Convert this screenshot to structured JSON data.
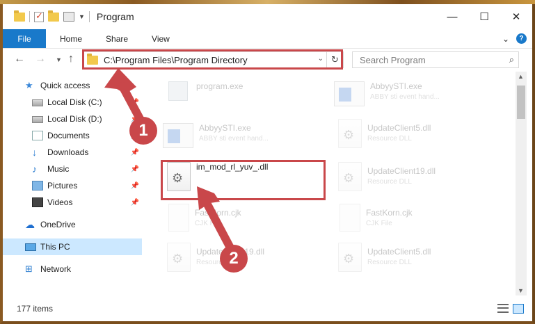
{
  "window": {
    "title": "Program",
    "minimize_glyph": "—",
    "maximize_glyph": "☐",
    "close_glyph": "✕"
  },
  "ribbon": {
    "tabs": [
      "File",
      "Home",
      "Share",
      "View"
    ],
    "expand_glyph": "⌄",
    "help_glyph": "?"
  },
  "address": {
    "path": "C:\\Program Files\\Program Directory",
    "search_placeholder": "Search Program"
  },
  "nav_pane": {
    "items": [
      {
        "label": "Quick access",
        "icon": "star-icon"
      },
      {
        "label": "Local Disk (C:)",
        "icon": "disk-icon"
      },
      {
        "label": "Local Disk (D:)",
        "icon": "disk-icon"
      },
      {
        "label": "Documents",
        "icon": "documents-icon"
      },
      {
        "label": "Downloads",
        "icon": "download-icon"
      },
      {
        "label": "Music",
        "icon": "music-icon"
      },
      {
        "label": "Pictures",
        "icon": "pictures-icon"
      },
      {
        "label": "Videos",
        "icon": "videos-icon"
      },
      {
        "label": "OneDrive",
        "icon": "cloud-icon"
      },
      {
        "label": "This PC",
        "icon": "computer-icon"
      },
      {
        "label": "Network",
        "icon": "network-icon"
      }
    ]
  },
  "files": [
    {
      "name": "program.exe",
      "type": "",
      "icon": "program-icon"
    },
    {
      "name": "AbbyySTI.exe",
      "type": "ABBY sti event hand...",
      "icon": "exe-icon"
    },
    {
      "name": "AbbyySTI.exe",
      "type": "ABBY sti event hand...",
      "icon": "exe-icon"
    },
    {
      "name": "UpdateClient5.dll",
      "type": "Resource DLL",
      "icon": "dll-icon"
    },
    {
      "name": "im_mod_rl_yuv_.dll",
      "type": "",
      "icon": "dll-icon"
    },
    {
      "name": "UpdateClient19.dll",
      "type": "Resource DLL",
      "icon": "dll-icon"
    },
    {
      "name": "FastKorn.cjk",
      "type": "CJK File",
      "icon": "cjk-icon"
    },
    {
      "name": "FastKorn.cjk",
      "type": "CJK File",
      "icon": "cjk-icon"
    },
    {
      "name": "UpdateClient19.dll",
      "type": "Resource DLL",
      "icon": "dll-icon"
    },
    {
      "name": "UpdateClient5.dll",
      "type": "Resource DLL",
      "icon": "dll-icon"
    }
  ],
  "status": {
    "item_count": "177 items"
  },
  "annotations": {
    "step1": "1",
    "step2": "2",
    "accent": "#c9474a"
  },
  "colors": {
    "file_tab": "#1979ca",
    "selected_nav": "#cce8ff"
  }
}
